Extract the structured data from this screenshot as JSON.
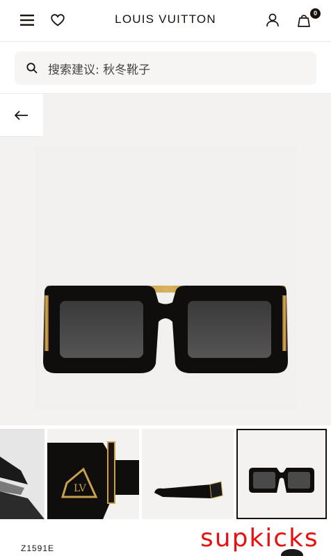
{
  "header": {
    "brand": "LOUIS VUITTON",
    "cart_count": "0"
  },
  "search": {
    "placeholder": "搜索建议: 秋冬靴子"
  },
  "product": {
    "sku": "Z1591E"
  },
  "watermark": "supkicks",
  "icons": {
    "menu": "menu-icon",
    "wishlist": "heart-icon",
    "account": "user-icon",
    "cart": "bag-icon",
    "search": "search-icon",
    "back": "arrow-left-icon"
  },
  "colors": {
    "text": "#19110b",
    "hero_bg": "#f3f2f0",
    "watermark": "#e81010",
    "gold": "#b58a3a"
  },
  "thumbnails": [
    {
      "view": "model wearing"
    },
    {
      "view": "temple logo close-up"
    },
    {
      "view": "side profile"
    },
    {
      "view": "front view",
      "selected": true
    }
  ]
}
